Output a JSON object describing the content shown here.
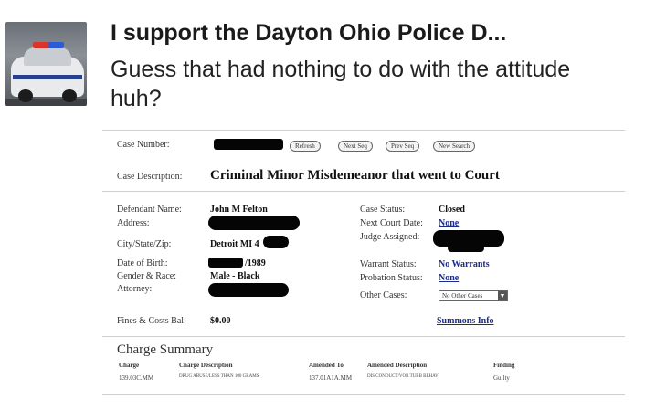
{
  "post": {
    "title": "I support the Dayton Ohio Police D...",
    "body": "Guess that had nothing to do with the attitude huh?"
  },
  "case": {
    "number_label": "Case Number:",
    "buttons": [
      "Refresh",
      "Next Seq",
      "Prev Seq",
      "New Search"
    ],
    "description_label": "Case Description:",
    "description": "Criminal Minor Misdemeanor that went to Court",
    "defendant_label": "Defendant Name:",
    "defendant": "John M Felton",
    "address_label": "Address:",
    "city_label": "City/State/Zip:",
    "city": "Detroit MI 4",
    "dob_label": "Date of Birth:",
    "dob": "/1989",
    "gender_label": "Gender & Race:",
    "gender": "Male - Black",
    "attorney_label": "Attorney:",
    "fines_label": "Fines & Costs Bal:",
    "fines": "$0.00",
    "status_label": "Case Status:",
    "status": "Closed",
    "next_court_label": "Next Court Date:",
    "next_court": "None",
    "judge_label": "Judge Assigned:",
    "warrant_label": "Warrant Status:",
    "warrant": "No Warrants",
    "probation_label": "Probation Status:",
    "probation": "None",
    "other_cases_label": "Other Cases:",
    "other_cases": "No Other Cases",
    "summons_link": "Summons Info"
  },
  "charge_summary": {
    "title": "Charge Summary",
    "headers": [
      "Charge",
      "Charge Description",
      "Amended To",
      "Amended Description",
      "Finding"
    ],
    "row": [
      "139.03C.MM",
      "DRUG ABUSE/LESS THAN 100 GRAMS",
      "137.01A1A.MM",
      "DIS CONDUCT/VOR TURB BEHAV",
      "Guilty"
    ]
  }
}
